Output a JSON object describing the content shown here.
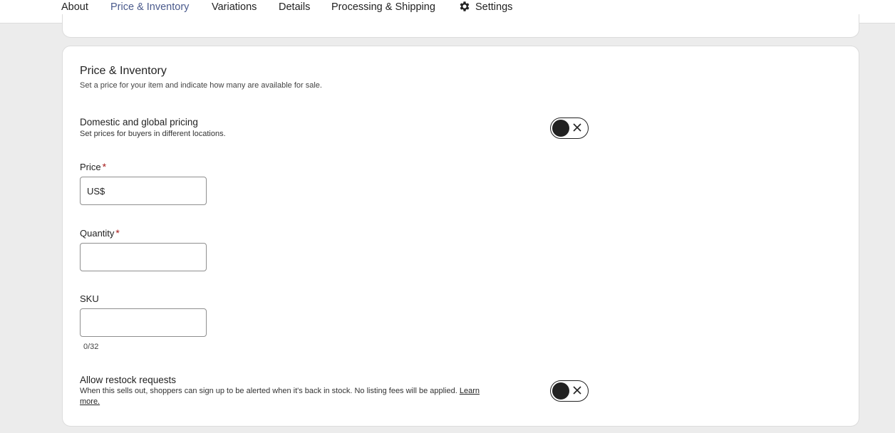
{
  "tabs": [
    {
      "label": "About",
      "active": false
    },
    {
      "label": "Price & Inventory",
      "active": true
    },
    {
      "label": "Variations",
      "active": false
    },
    {
      "label": "Details",
      "active": false
    },
    {
      "label": "Processing & Shipping",
      "active": false
    },
    {
      "label": "Settings",
      "active": false,
      "icon": "gear-icon"
    }
  ],
  "section": {
    "title": "Price & Inventory",
    "subtitle": "Set a price for your item and indicate how many are available for sale."
  },
  "global_pricing": {
    "title": "Domestic and global pricing",
    "subtitle": "Set prices for buyers in different locations.",
    "enabled": false
  },
  "price": {
    "label": "Price",
    "required_mark": "*",
    "prefix": "US$",
    "value": ""
  },
  "quantity": {
    "label": "Quantity",
    "required_mark": "*",
    "value": ""
  },
  "sku": {
    "label": "SKU",
    "value": "",
    "counter": "0/32"
  },
  "restock": {
    "title": "Allow restock requests",
    "subtitle": "When this sells out, shoppers can sign up to be alerted when it's back in stock. No listing fees will be applied.",
    "link_text_1": "Learn",
    "link_text_2": "more.",
    "enabled": false
  },
  "colors": {
    "accent": "#4a5a8c",
    "required": "#a61a1a",
    "background": "#ececec"
  }
}
